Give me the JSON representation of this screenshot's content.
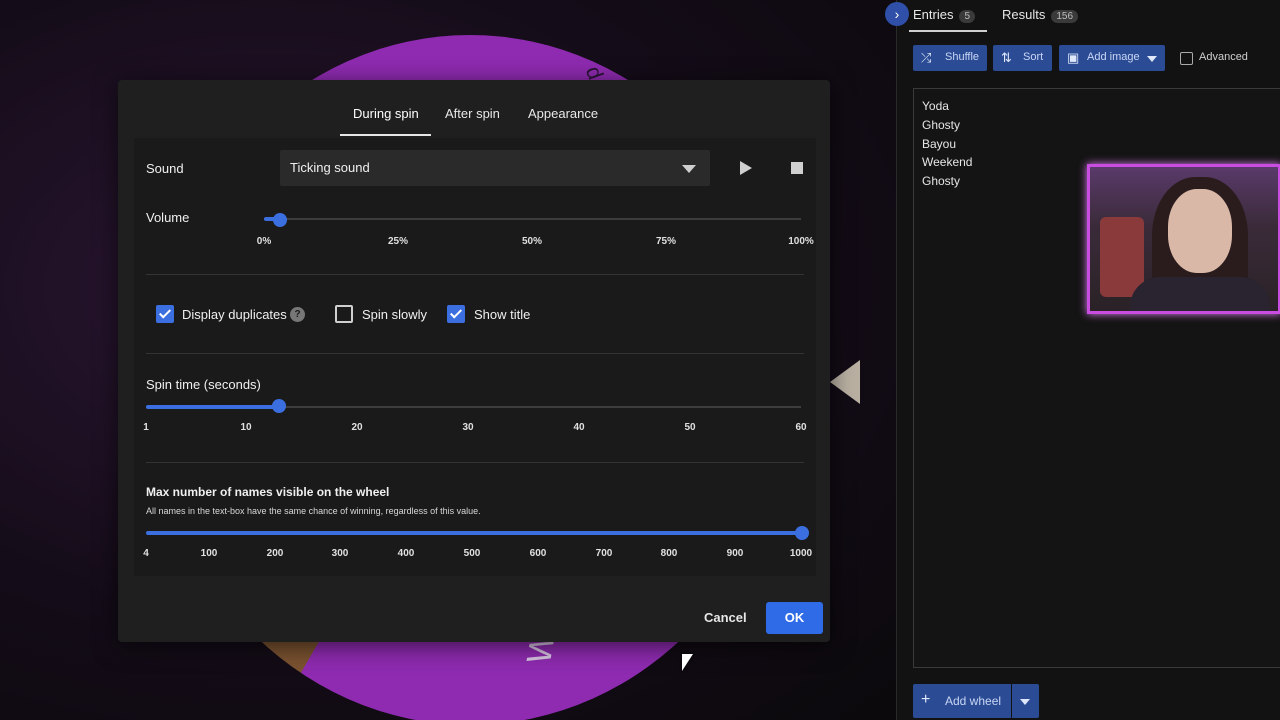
{
  "background": {
    "wheel_text_top": "d",
    "wheel_text_bottom": "Weekend"
  },
  "dialog": {
    "tabs": [
      "During spin",
      "After spin",
      "Appearance"
    ],
    "active_tab": "During spin",
    "sound": {
      "label": "Sound",
      "selected": "Ticking sound"
    },
    "volume": {
      "label": "Volume",
      "value_percent": 2,
      "ticks": [
        "0%",
        "25%",
        "50%",
        "75%",
        "100%"
      ]
    },
    "checkboxes": [
      {
        "label": "Display duplicates",
        "checked": true,
        "help": "?"
      },
      {
        "label": "Spin slowly",
        "checked": false
      },
      {
        "label": "Show title",
        "checked": true
      }
    ],
    "spin_time": {
      "label": "Spin time (seconds)",
      "value": 12,
      "ticks": [
        "1",
        "10",
        "20",
        "30",
        "40",
        "50",
        "60"
      ]
    },
    "max_names": {
      "label": "Max number of names visible on the wheel",
      "hint": "All names in the text-box have the same chance of winning, regardless of this value.",
      "value": 1000,
      "ticks": [
        "4",
        "100",
        "200",
        "300",
        "400",
        "500",
        "600",
        "700",
        "800",
        "900",
        "1000"
      ]
    },
    "cancel_label": "Cancel",
    "ok_label": "OK"
  },
  "side": {
    "tabs": {
      "entries_label": "Entries",
      "entries_count": "5",
      "results_label": "Results",
      "results_count": "156"
    },
    "toolbar": {
      "shuffle": "Shuffle",
      "sort": "Sort",
      "add_image": "Add image",
      "advanced": "Advanced"
    },
    "entries": [
      "Yoda",
      "Ghosty",
      "Bayou",
      "Weekend",
      "Ghosty"
    ],
    "add_wheel": "Add wheel"
  },
  "colors": {
    "accent": "#3b6fe0",
    "button_blue": "#2f6be6",
    "side_button": "#2b4c94",
    "wheel_purple": "#8e2bb0"
  }
}
